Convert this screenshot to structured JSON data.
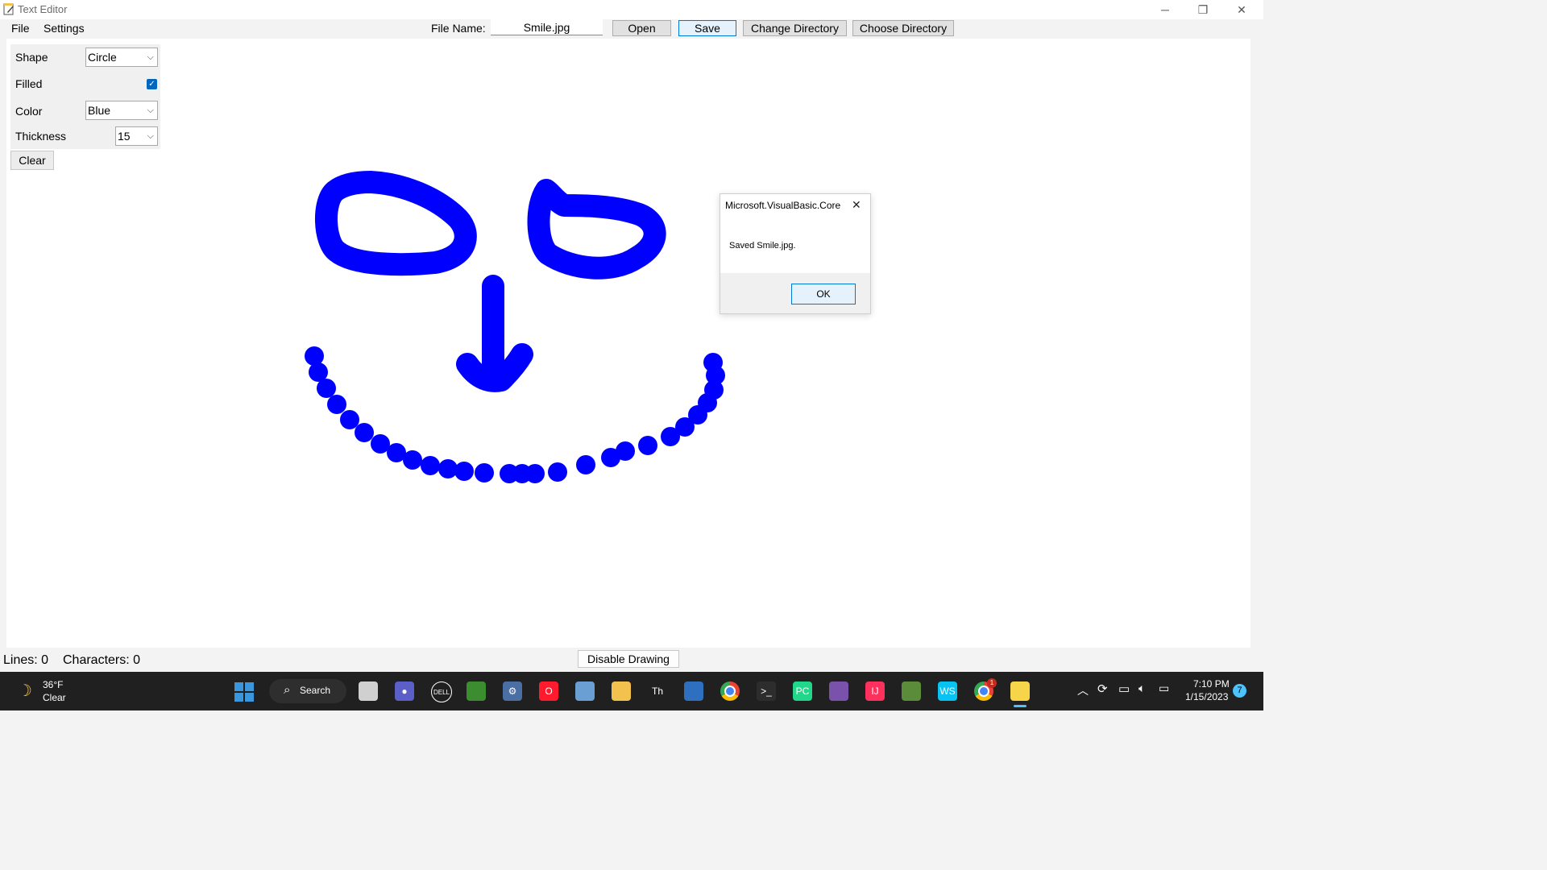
{
  "window": {
    "title": "Text Editor",
    "minimize_glyph": "─",
    "maximize_glyph": "❐",
    "close_glyph": "✕"
  },
  "menu": {
    "file": "File",
    "settings": "Settings"
  },
  "toolbar": {
    "file_name_label": "File Name:",
    "file_name_value": "Smile.jpg",
    "open": "Open",
    "save": "Save",
    "change_directory": "Change Directory",
    "choose_directory": "Choose Directory"
  },
  "settings": {
    "shape_label": "Shape",
    "shape_value": "Circle",
    "filled_label": "Filled",
    "filled_checked": true,
    "check_glyph": "✓",
    "color_label": "Color",
    "color_value": "Blue",
    "thickness_label": "Thickness",
    "thickness_value": "15",
    "clear": "Clear",
    "chevron_glyph": "⌵"
  },
  "drawing": {
    "color": "#0000ff"
  },
  "dialog": {
    "title": "Microsoft.VisualBasic.Core",
    "close_glyph": "✕",
    "message": "Saved Smile.jpg.",
    "ok": "OK"
  },
  "status": {
    "lines": "Lines: 0",
    "characters": "Characters: 0",
    "disable_drawing": "Disable Drawing"
  },
  "taskbar": {
    "weather_temp": "36°F",
    "weather_desc": "Clear",
    "search_label": "Search",
    "time": "7:10 PM",
    "date": "1/15/2023",
    "notification_count": "7",
    "chrome_badge": "1",
    "icons": [
      {
        "name": "windows-start-icon",
        "color": "#3a96dd",
        "glyph": ""
      },
      {
        "name": "task-view-icon",
        "color": "#d0d0d0",
        "glyph": ""
      },
      {
        "name": "zoom-icon",
        "color": "#5b5fc7",
        "glyph": "●"
      },
      {
        "name": "dell-icon",
        "color": "#202020",
        "glyph": "DELL"
      },
      {
        "name": "image-app-icon",
        "color": "#3c8d2f",
        "glyph": ""
      },
      {
        "name": "settings-gear-icon",
        "color": "#4a6fa5",
        "glyph": "⚙"
      },
      {
        "name": "opera-icon",
        "color": "#ff1b2d",
        "glyph": "O"
      },
      {
        "name": "monitor-app-icon",
        "color": "#6a9fd4",
        "glyph": ""
      },
      {
        "name": "file-explorer-icon",
        "color": "#f2c14e",
        "glyph": ""
      },
      {
        "name": "font-app-icon",
        "color": "#202020",
        "glyph": "Th"
      },
      {
        "name": "network-app-icon",
        "color": "#2f6fbf",
        "glyph": ""
      },
      {
        "name": "chrome-icon",
        "color": "#34a853",
        "glyph": ""
      },
      {
        "name": "terminal-icon",
        "color": "#2d2d2d",
        "glyph": ">_"
      },
      {
        "name": "pycharm-icon",
        "color": "#21d789",
        "glyph": "PC"
      },
      {
        "name": "visual-studio-icon",
        "color": "#7b52ab",
        "glyph": ""
      },
      {
        "name": "intellij-icon",
        "color": "#fe315d",
        "glyph": "IJ"
      },
      {
        "name": "minecraft-icon",
        "color": "#5b8c3a",
        "glyph": ""
      },
      {
        "name": "webstorm-icon",
        "color": "#07c3f2",
        "glyph": "WS"
      },
      {
        "name": "chrome-profile-icon",
        "color": "#34a853",
        "glyph": ""
      },
      {
        "name": "notepad-app-icon",
        "color": "#f7d54a",
        "glyph": ""
      }
    ]
  }
}
